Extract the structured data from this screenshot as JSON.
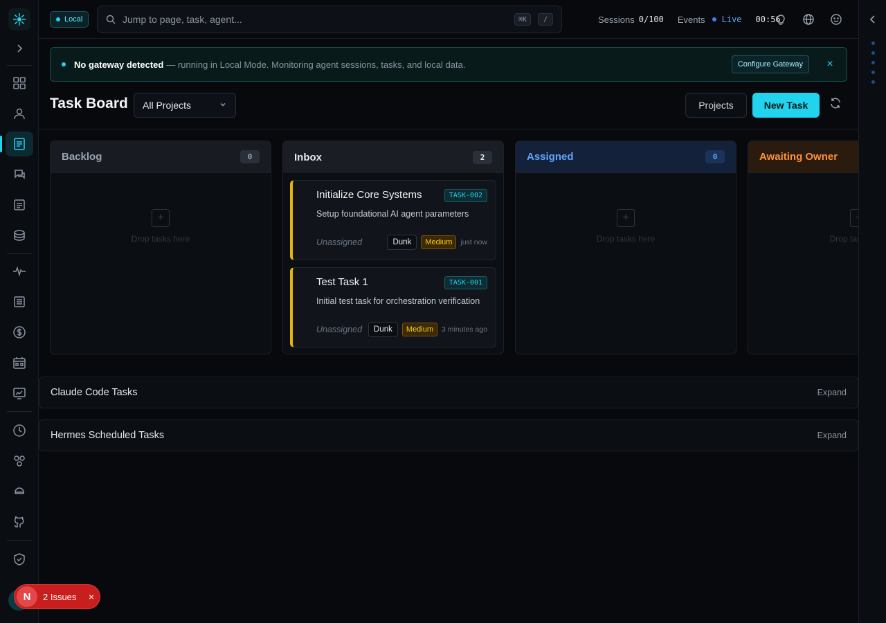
{
  "topbar": {
    "mode_badge": "Local",
    "search_placeholder": "Jump to page, task, agent...",
    "shortcut_cmd": "⌘K",
    "shortcut_slash": "/",
    "sessions_label": "Sessions",
    "sessions_value": "0/100",
    "events_label": "Events",
    "events_status": "Live",
    "clock": "00:56"
  },
  "banner": {
    "title": "No gateway detected",
    "description": "— running in Local Mode. Monitoring agent sessions, tasks, and local data.",
    "action": "Configure Gateway",
    "close": "×"
  },
  "board": {
    "title": "Task Board",
    "project_filter": "All Projects",
    "projects_button": "Projects",
    "new_task_button": "New Task"
  },
  "columns": [
    {
      "name": "Backlog",
      "count": "0",
      "empty_text": "Drop tasks here",
      "color": "#9aa3ae"
    },
    {
      "name": "Inbox",
      "count": "2",
      "empty_text": "",
      "color": "#e6e8eb"
    },
    {
      "name": "Assigned",
      "count": "0",
      "empty_text": "Drop tasks here",
      "color": "#60a5fa"
    },
    {
      "name": "Awaiting Owner",
      "count": "",
      "empty_text": "Drop tasks here",
      "color": "#fb923c"
    }
  ],
  "tasks": [
    {
      "title": "Initialize Core Systems",
      "id": "TASK-002",
      "description": "Setup foundational AI agent parameters",
      "assignee": "Unassigned",
      "project": "Dunk",
      "priority": "Medium",
      "time": "just now"
    },
    {
      "title": "Test Task 1",
      "id": "TASK-001",
      "description": "Initial test task for orchestration verification",
      "assignee": "Unassigned",
      "project": "Dunk",
      "priority": "Medium",
      "time": "3 minutes ago"
    }
  ],
  "sections": [
    {
      "title": "Claude Code Tasks",
      "action": "Expand"
    },
    {
      "title": "Hermes Scheduled Tasks",
      "action": "Expand"
    }
  ],
  "issues": {
    "logo": "N",
    "label": "2 Issues",
    "close": "×"
  },
  "colors": {
    "accent": "#22d3ee",
    "priority_medium": "#facc15",
    "assigned": "#60a5fa",
    "awaiting": "#fb923c",
    "issues": "#c81e1e"
  },
  "icons": {
    "rail": [
      "logo-icon",
      "expand-icon",
      "dashboard-icon",
      "agents-icon",
      "tasks-icon",
      "chat-icon",
      "docs-icon",
      "database-icon",
      "activity-icon",
      "logs-icon",
      "cost-icon",
      "calendar-icon",
      "analytics-icon",
      "history-icon",
      "integrations-icon",
      "memory-icon",
      "github-icon",
      "security-icon"
    ],
    "top": [
      "search-icon",
      "bulb-icon",
      "globe-icon",
      "smiley-icon"
    ]
  }
}
